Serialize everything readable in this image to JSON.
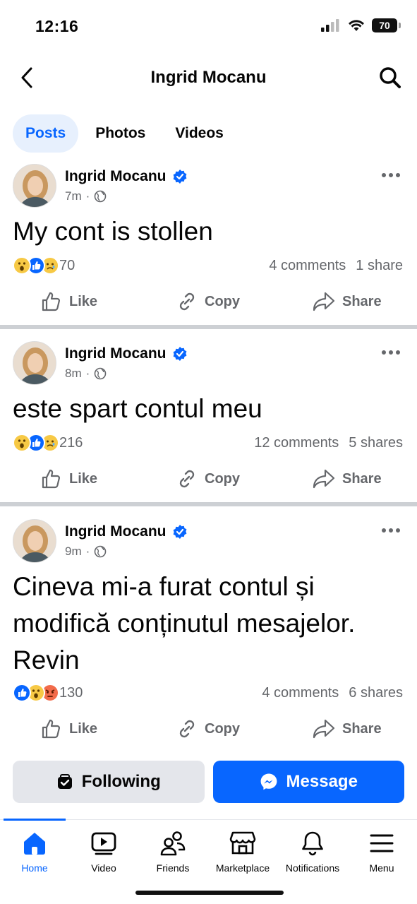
{
  "status": {
    "time": "12:16",
    "battery": "70"
  },
  "header": {
    "title": "Ingrid Mocanu"
  },
  "tabs": [
    {
      "label": "Posts",
      "active": true
    },
    {
      "label": "Photos",
      "active": false
    },
    {
      "label": "Videos",
      "active": false
    }
  ],
  "posts": [
    {
      "author": "Ingrid Mocanu",
      "time": "7m",
      "text": "My cont is stollen",
      "reactions": [
        "wow",
        "like",
        "sad"
      ],
      "reaction_count": "70",
      "comments": "4 comments",
      "shares": "1 share"
    },
    {
      "author": "Ingrid Mocanu",
      "time": "8m",
      "text": "este spart contul meu",
      "reactions": [
        "wow",
        "like",
        "sad"
      ],
      "reaction_count": "216",
      "comments": "12 comments",
      "shares": "5 shares"
    },
    {
      "author": "Ingrid Mocanu",
      "time": "9m",
      "text": "Cineva mi-a furat contul și modifică conținutul mesajelor. Revin",
      "reactions": [
        "like",
        "wow",
        "angry"
      ],
      "reaction_count": "130",
      "comments": "4 comments",
      "shares": "6 shares"
    }
  ],
  "actions": {
    "like": "Like",
    "copy": "Copy",
    "share": "Share"
  },
  "cta": {
    "following": "Following",
    "message": "Message"
  },
  "nav": [
    {
      "label": "Home",
      "icon": "home-icon",
      "active": true
    },
    {
      "label": "Video",
      "icon": "video-icon",
      "active": false
    },
    {
      "label": "Friends",
      "icon": "friends-icon",
      "active": false
    },
    {
      "label": "Marketplace",
      "icon": "marketplace-icon",
      "active": false
    },
    {
      "label": "Notifications",
      "icon": "bell-icon",
      "active": false
    },
    {
      "label": "Menu",
      "icon": "menu-icon",
      "active": false
    }
  ],
  "colors": {
    "accent": "#0866ff",
    "verified": "#0866ff",
    "secondary_text": "#65676b"
  }
}
